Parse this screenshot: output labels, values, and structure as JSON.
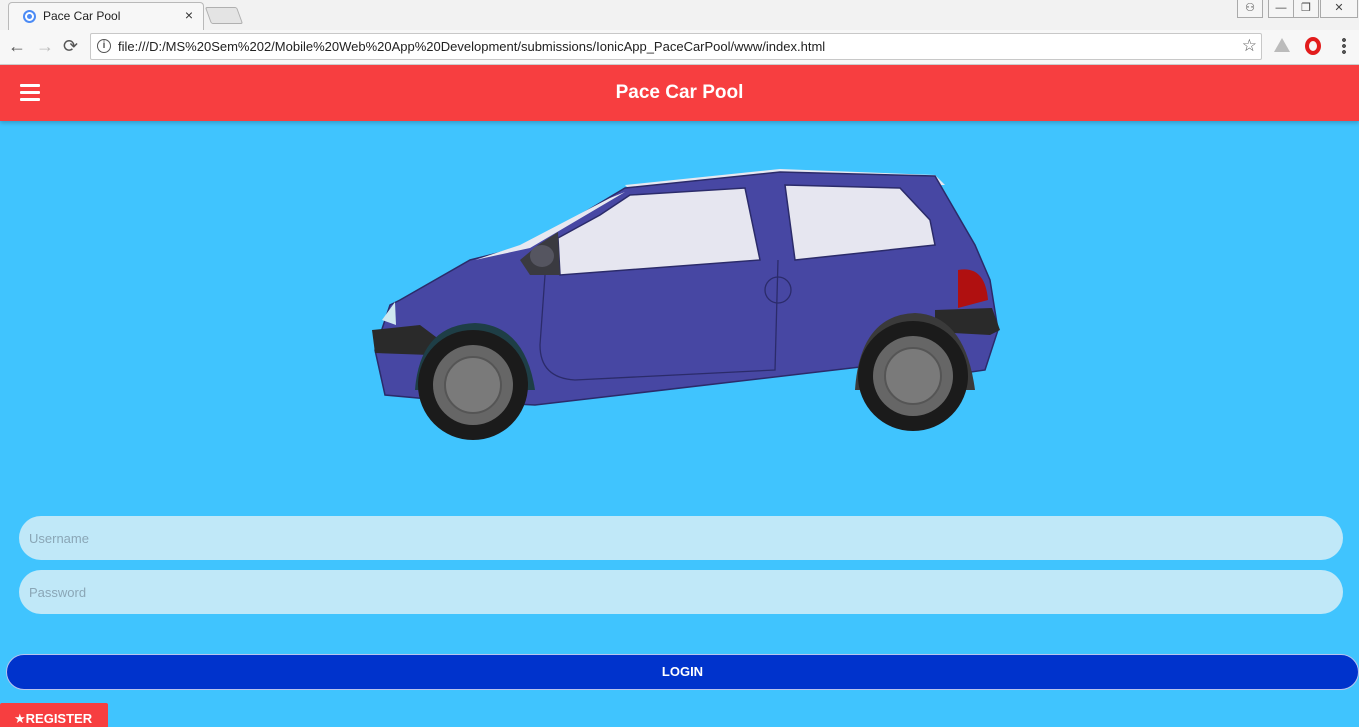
{
  "browser": {
    "tab_title": "Pace Car Pool",
    "tab_close": "×",
    "url": "file:///D:/MS%20Sem%202/Mobile%20Web%20App%20Development/submissions/IonicApp_PaceCarPool/www/index.html",
    "nav": {
      "back": "←",
      "forward": "→",
      "reload": "⟳"
    },
    "bookmark_icon": "☆",
    "info_icon": "i",
    "window_controls": [
      "⚇",
      "—",
      "❐",
      "✕"
    ]
  },
  "app": {
    "title": "Pace Car Pool",
    "menu_icon": "hamburger-menu-icon",
    "hero_image": "car-illustration",
    "colors": {
      "header": "#f73e40",
      "background": "#40c4fe",
      "login": "#0033cc",
      "input": "#c0e8f8"
    }
  },
  "form": {
    "username_placeholder": "Username",
    "password_placeholder": "Password",
    "login_label": "LOGIN",
    "register_label": "★REGISTER"
  }
}
